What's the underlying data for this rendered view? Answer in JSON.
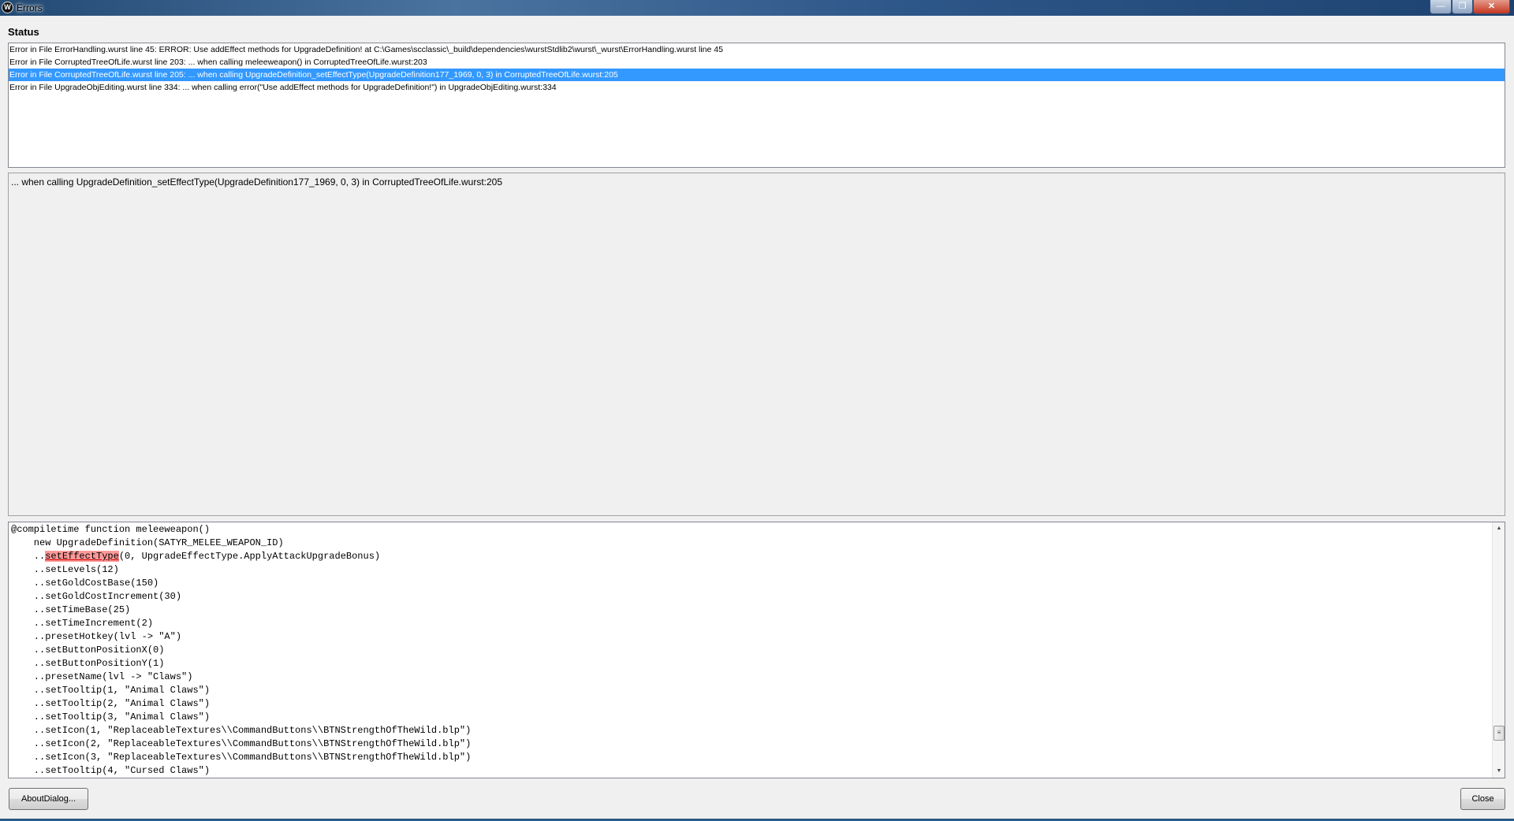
{
  "window": {
    "title": "Errors",
    "icon": "w-logo-icon",
    "controls": {
      "minimize": "—",
      "maximize": "❐",
      "close": "✕"
    }
  },
  "status_label": "Status",
  "errors": [
    "Error in File ErrorHandling.wurst line 45: ERROR: Use addEffect methods for UpgradeDefinition!  at C:\\Games\\scclassic\\_build\\dependencies\\wurstStdlib2\\wurst\\_wurst\\ErrorHandling.wurst line 45",
    "Error in File CorruptedTreeOfLife.wurst line 203: ... when calling meleeweapon() in CorruptedTreeOfLife.wurst:203",
    "Error in File CorruptedTreeOfLife.wurst line 205: ... when calling UpgradeDefinition_setEffectType(UpgradeDefinition177_1969, 0, 3) in CorruptedTreeOfLife.wurst:205",
    "Error in File UpgradeObjEditing.wurst line 334: ... when calling error(\"Use addEffect methods for UpgradeDefinition!\") in UpgradeObjEditing.wurst:334"
  ],
  "selected_error_index": 2,
  "detail": "... when calling UpgradeDefinition_setEffectType(UpgradeDefinition177_1969, 0, 3) in CorruptedTreeOfLife.wurst:205",
  "code": {
    "line0": "@compiletime function meleeweapon()",
    "line1": "    new UpgradeDefinition(SATYR_MELEE_WEAPON_ID)",
    "line2_prefix": "    ..",
    "line2_highlight": "setEffectType",
    "line2_suffix": "(0, UpgradeEffectType.ApplyAttackUpgradeBonus)",
    "rest": "    ..setLevels(12)\n    ..setGoldCostBase(150)\n    ..setGoldCostIncrement(30)\n    ..setTimeBase(25)\n    ..setTimeIncrement(2)\n    ..presetHotkey(lvl -> \"A\")\n    ..setButtonPositionX(0)\n    ..setButtonPositionY(1)\n    ..presetName(lvl -> \"Claws\")\n    ..setTooltip(1, \"Animal Claws\")\n    ..setTooltip(2, \"Animal Claws\")\n    ..setTooltip(3, \"Animal Claws\")\n    ..setIcon(1, \"ReplaceableTextures\\\\CommandButtons\\\\BTNStrengthOfTheWild.blp\")\n    ..setIcon(2, \"ReplaceableTextures\\\\CommandButtons\\\\BTNStrengthOfTheWild.blp\")\n    ..setIcon(3, \"ReplaceableTextures\\\\CommandButtons\\\\BTNStrengthOfTheWild.blp\")\n    ..setTooltip(4, \"Cursed Claws\")"
  },
  "buttons": {
    "about": "AboutDialog...",
    "close": "Close"
  },
  "scroll_glyphs": {
    "up": "▲",
    "down": "▼",
    "thumb": "≡"
  }
}
